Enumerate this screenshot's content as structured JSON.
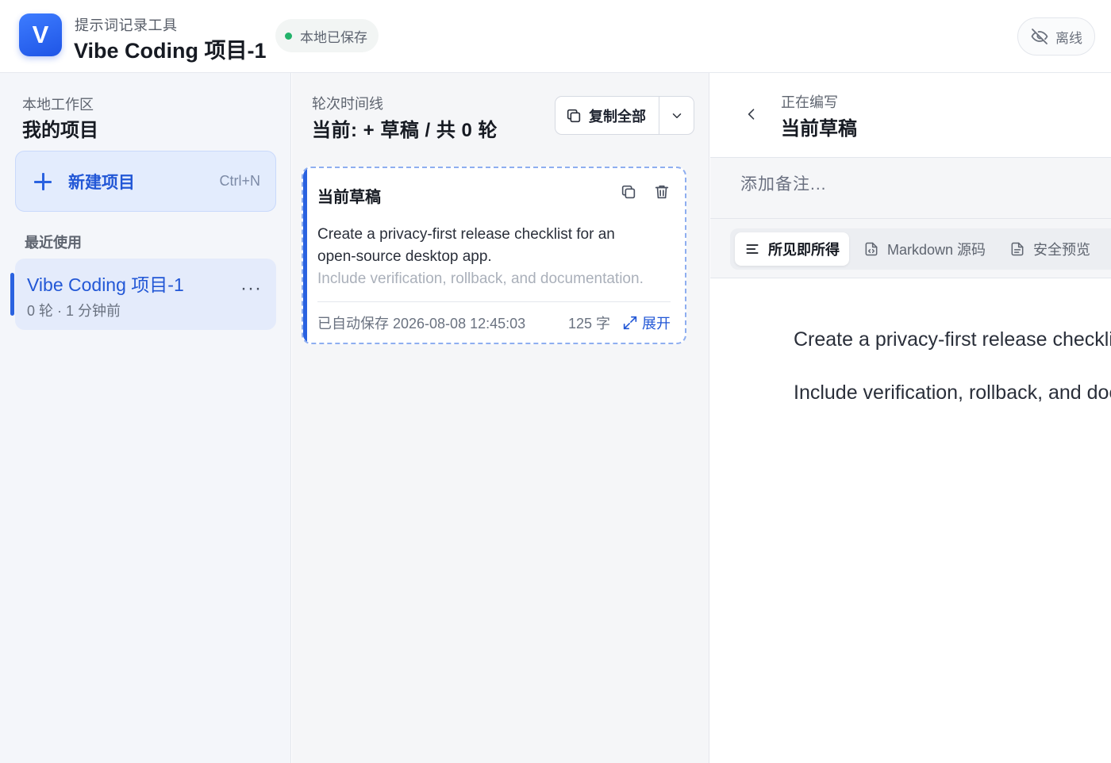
{
  "header": {
    "logo_letter": "V",
    "app_name": "提示词记录工具",
    "project_title": "Vibe Coding 项目-1",
    "save_status": "本地已保存",
    "offline_label": "离线"
  },
  "sidebar": {
    "workspace_label": "本地工作区",
    "workspace_title": "我的项目",
    "new_project_label": "新建项目",
    "new_project_shortcut": "Ctrl+N",
    "recent_label": "最近使用",
    "projects": [
      {
        "name": "Vibe Coding 项目-1",
        "meta": "0 轮 · 1 分钟前",
        "more": "···"
      }
    ]
  },
  "timeline": {
    "label": "轮次时间线",
    "status": "当前: + 草稿 / 共 0 轮",
    "copy_all_label": "复制全部",
    "draft_card": {
      "title": "当前草稿",
      "line1": "Create a privacy-first release checklist for an",
      "line2": "open-source desktop app.",
      "line3": "Include verification, rollback, and documentation.",
      "autosave": "已自动保存 2026-08-08 12:45:03",
      "char_count": "125 字",
      "expand_label": "展开"
    }
  },
  "editor": {
    "label": "正在编写",
    "title": "当前草稿",
    "note_placeholder": "添加备注...",
    "modes": [
      {
        "label": "所见即所得",
        "icon": "align-left-icon",
        "active": true
      },
      {
        "label": "Markdown 源码",
        "icon": "file-code-icon",
        "active": false
      },
      {
        "label": "安全预览",
        "icon": "document-icon",
        "active": false
      }
    ],
    "content": [
      "Create a privacy-first release checklist for an open-source desktop app.",
      "Include verification, rollback, and documentation."
    ]
  },
  "colors": {
    "accent": "#2a62e0",
    "saved_dot": "#22b26a",
    "sidebar_bg": "#f4f6fa"
  }
}
